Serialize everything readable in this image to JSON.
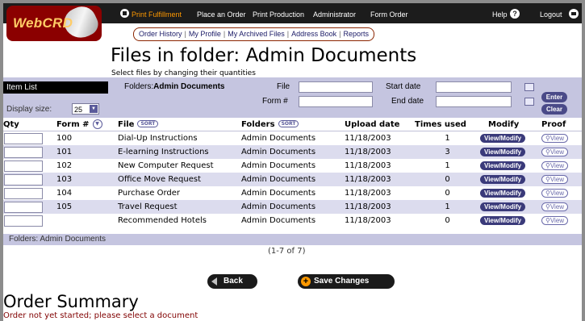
{
  "app": {
    "logo_text": "WebCRD"
  },
  "top_nav": {
    "items": [
      {
        "label": "Print Fulfillment"
      },
      {
        "label": "Place an Order"
      },
      {
        "label": "Print Production"
      },
      {
        "label": "Administrator"
      },
      {
        "label": "Form Order"
      }
    ],
    "help_label": "Help",
    "logout_label": "Logout"
  },
  "sub_nav": {
    "items": [
      {
        "label": "Order History"
      },
      {
        "label": "My Profile"
      },
      {
        "label": "My Archived Files"
      },
      {
        "label": "Address Book"
      },
      {
        "label": "Reports"
      }
    ],
    "separator": "|"
  },
  "page": {
    "title": "Files in folder: Admin Documents",
    "instruction": "Select files by changing their quantities"
  },
  "filter": {
    "item_list_label": "Item List",
    "folders_label": "Folders:",
    "folders_value": "Admin Documents",
    "file_label": "File",
    "file_value": "",
    "form_label": "Form #",
    "form_value": "",
    "start_date_label": "Start date",
    "start_date_value": "",
    "end_date_label": "End date",
    "end_date_value": "",
    "display_size_label": "Display size:",
    "display_size_value": "25",
    "enter_label": "Enter",
    "clear_label": "Clear"
  },
  "table": {
    "headers": {
      "qty": "Qty",
      "form": "Form #",
      "file": "File",
      "sort_label": "SORT",
      "folders": "Folders",
      "upload_date": "Upload date",
      "times_used": "Times used",
      "modify": "Modify",
      "proof": "Proof"
    },
    "rows": [
      {
        "qty": "",
        "form": "100",
        "file": "Dial-Up Instructions",
        "folder": "Admin Documents",
        "upload_date": "11/18/2003",
        "times_used": "1",
        "modify": "View/Modify",
        "proof": "View"
      },
      {
        "qty": "",
        "form": "101",
        "file": "E-learning Instructions",
        "folder": "Admin Documents",
        "upload_date": "11/18/2003",
        "times_used": "3",
        "modify": "View/Modify",
        "proof": "View"
      },
      {
        "qty": "",
        "form": "102",
        "file": "New Computer Request",
        "folder": "Admin Documents",
        "upload_date": "11/18/2003",
        "times_used": "1",
        "modify": "View/Modify",
        "proof": "View"
      },
      {
        "qty": "",
        "form": "103",
        "file": "Office Move Request",
        "folder": "Admin Documents",
        "upload_date": "11/18/2003",
        "times_used": "0",
        "modify": "View/Modify",
        "proof": "View"
      },
      {
        "qty": "",
        "form": "104",
        "file": "Purchase Order",
        "folder": "Admin Documents",
        "upload_date": "11/18/2003",
        "times_used": "0",
        "modify": "View/Modify",
        "proof": "View"
      },
      {
        "qty": "",
        "form": "105",
        "file": "Travel Request",
        "folder": "Admin Documents",
        "upload_date": "11/18/2003",
        "times_used": "1",
        "modify": "View/Modify",
        "proof": "View"
      },
      {
        "qty": "",
        "form": "",
        "file": "Recommended Hotels",
        "folder": "Admin Documents",
        "upload_date": "11/18/2003",
        "times_used": "0",
        "modify": "View/Modify",
        "proof": "View"
      }
    ]
  },
  "footer": {
    "folders_text": "Folders: Admin Documents",
    "pagination": "(1-7 of 7)"
  },
  "actions": {
    "back_label": "Back",
    "save_label": "Save Changes"
  },
  "order_summary": {
    "title": "Order Summary",
    "status": "Order not yet started; please select a document"
  },
  "colors": {
    "accent": "#ff9900",
    "panel": "#c5c5e0",
    "brand": "#8b0000",
    "button": "#3a3a7a"
  }
}
